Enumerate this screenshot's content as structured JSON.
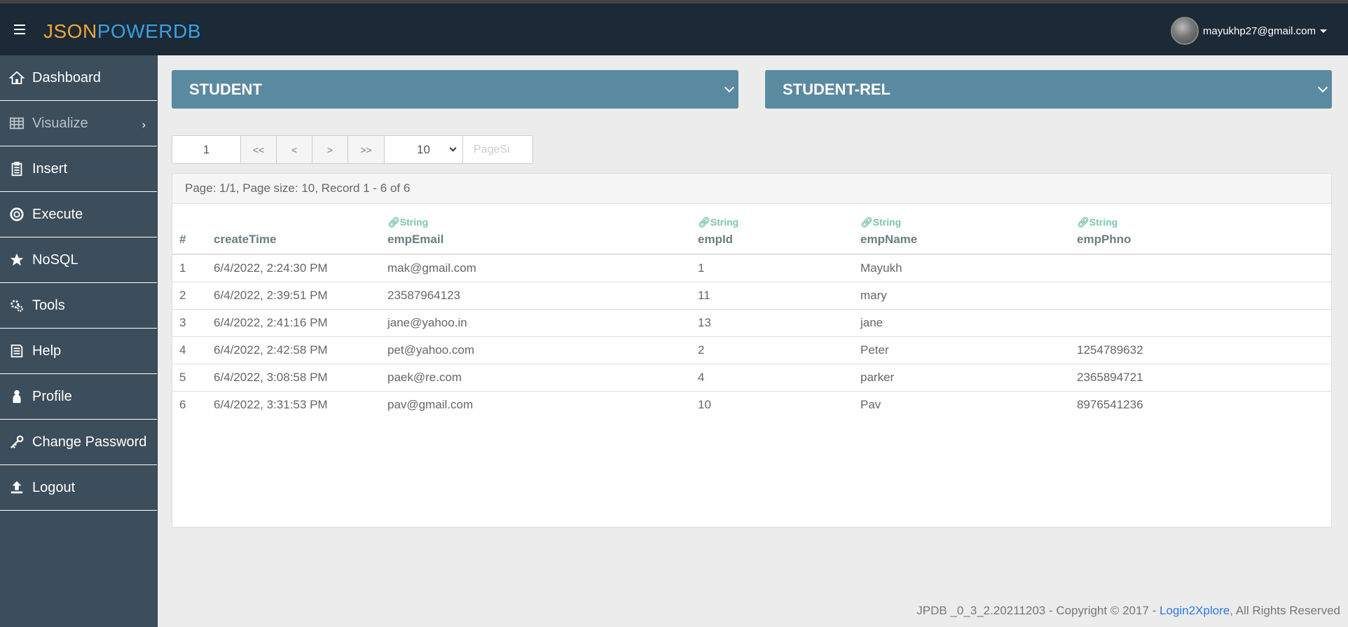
{
  "brand": {
    "part1": "JSON",
    "part2": "POWERDB",
    "color1": "#f0a53a",
    "color2": "#3aa0e0"
  },
  "user": {
    "email": "mayukhp27@gmail.com"
  },
  "sidebar": {
    "items": [
      {
        "label": "Dashboard",
        "icon": "home-icon"
      },
      {
        "label": "Visualize",
        "icon": "table-icon"
      },
      {
        "label": "Insert",
        "icon": "clipboard-icon"
      },
      {
        "label": "Execute",
        "icon": "lifebuoy-icon"
      },
      {
        "label": "NoSQL",
        "icon": "star-icon"
      },
      {
        "label": "Tools",
        "icon": "gears-icon"
      },
      {
        "label": "Help",
        "icon": "book-icon"
      },
      {
        "label": "Profile",
        "icon": "user-icon"
      },
      {
        "label": "Change Password",
        "icon": "key-icon"
      },
      {
        "label": "Logout",
        "icon": "upload-icon"
      }
    ]
  },
  "selectors": {
    "database": "STUDENT",
    "relation": "STUDENT-REL"
  },
  "pager": {
    "page": "1",
    "first": "<<",
    "prev": "<",
    "next": ">",
    "last": ">>",
    "page_size": "10",
    "page_size_placeholder": "PageSi"
  },
  "summary": "Page: 1/1, Page size: 10, Record 1 - 6 of 6",
  "table": {
    "type_label": "String",
    "columns": [
      "#",
      "createTime",
      "empEmail",
      "empId",
      "empName",
      "empPhno"
    ],
    "rows": [
      [
        "1",
        "6/4/2022, 2:24:30 PM",
        "mak@gmail.com",
        "1",
        "Mayukh",
        ""
      ],
      [
        "2",
        "6/4/2022, 2:39:51 PM",
        "23587964123",
        "11",
        "mary",
        ""
      ],
      [
        "3",
        "6/4/2022, 2:41:16 PM",
        "jane@yahoo.in",
        "13",
        "jane",
        ""
      ],
      [
        "4",
        "6/4/2022, 2:42:58 PM",
        "pet@yahoo.com",
        "2",
        "Peter",
        "1254789632"
      ],
      [
        "5",
        "6/4/2022, 3:08:58 PM",
        "paek@re.com",
        "4",
        "parker",
        "2365894721"
      ],
      [
        "6",
        "6/4/2022, 3:31:53 PM",
        "pav@gmail.com",
        "10",
        "Pav",
        "8976541236"
      ]
    ]
  },
  "footer": {
    "prefix": "JPDB _0_3_2.20211203 - Copyright © 2017 - ",
    "link": "Login2Xplore",
    "suffix": ", All Rights Reserved"
  }
}
